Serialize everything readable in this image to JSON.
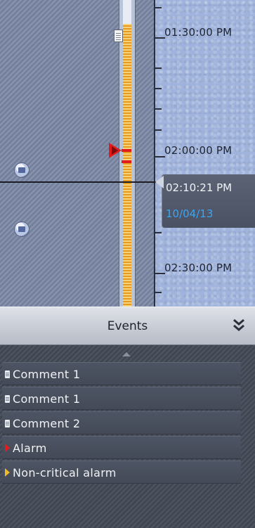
{
  "timeline": {
    "time_labels": [
      "01:30:00 PM",
      "02:00:00 PM",
      "02:30:00 PM"
    ],
    "cursor": {
      "time": "02:10:21 PM",
      "date": "10/04/13"
    }
  },
  "events_panel": {
    "title": "Events",
    "items": [
      {
        "label": "Comment 1",
        "type": "comment"
      },
      {
        "label": "Comment 1",
        "type": "comment"
      },
      {
        "label": "Comment 2",
        "type": "comment"
      },
      {
        "label": "Alarm",
        "type": "alarm"
      },
      {
        "label": "Non-critical alarm",
        "type": "non-critical-alarm"
      }
    ]
  },
  "colors": {
    "alarm": "#e01b1b",
    "non_critical_alarm": "#f0b92a",
    "date_text": "#3aa6f2"
  },
  "icons": {
    "collapse": "chevron-double-down-icon",
    "comment": "comment-icon",
    "alarm": "alarm-triangle-icon",
    "scroll_up": "scroll-up-icon",
    "scroll_down": "scroll-down-icon"
  }
}
